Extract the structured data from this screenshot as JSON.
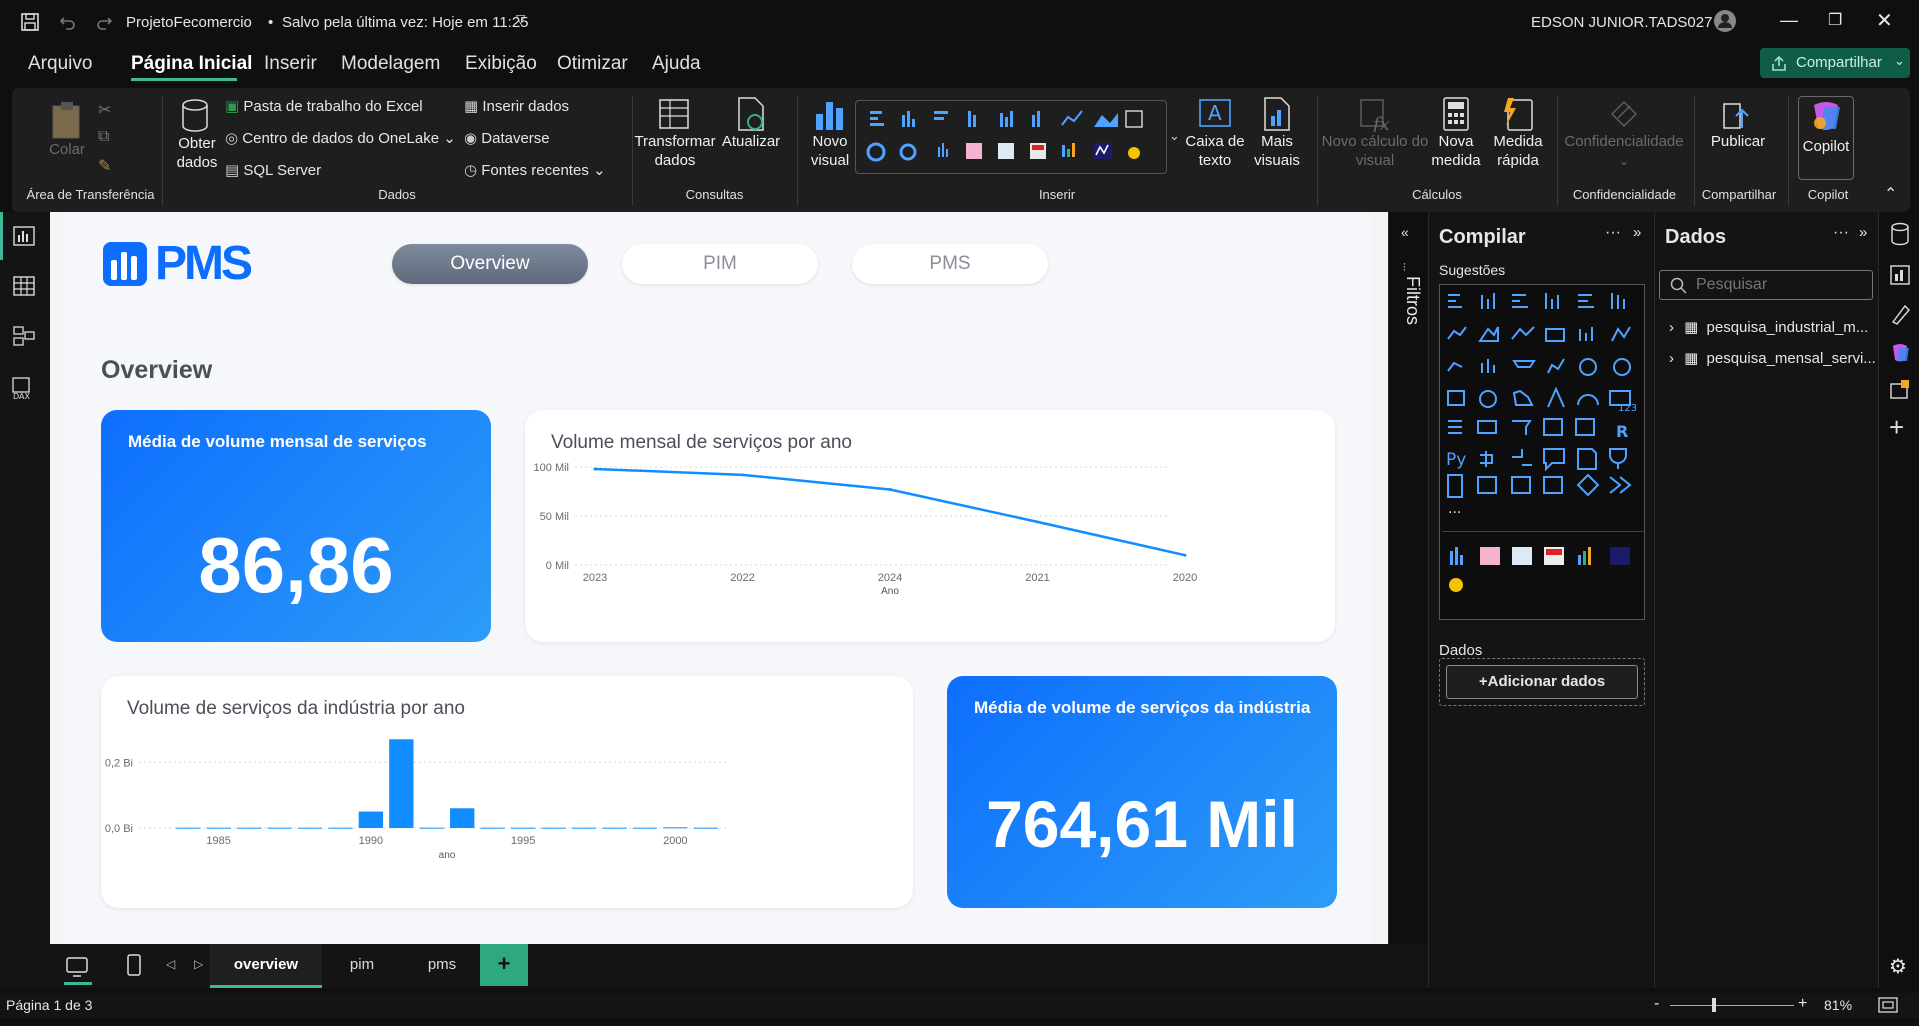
{
  "titlebar": {
    "title": "ProjetoFecomercio",
    "saved": "Salvo pela última vez: Hoje em 11:25",
    "user": "EDSON JUNIOR.TADS027"
  },
  "menu": [
    "Arquivo",
    "Página Inicial",
    "Inserir",
    "Modelagem",
    "Exibição",
    "Otimizar",
    "Ajuda"
  ],
  "share_label": "Compartilhar",
  "ribbon": {
    "paste": "Colar",
    "clipboard_group": "Área de Transferência",
    "get_data": "Obter dados",
    "excel": "Pasta de trabalho do Excel",
    "onelake": "Centro de dados do OneLake",
    "sql": "SQL Server",
    "insert_data": "Inserir dados",
    "dataverse": "Dataverse",
    "recent": "Fontes recentes",
    "data_group": "Dados",
    "transform": "Transformar dados",
    "refresh": "Atualizar",
    "queries_group": "Consultas",
    "new_visual": "Novo visual",
    "textbox": "Caixa de texto",
    "more_visuals": "Mais visuais",
    "insert_group": "Inserir",
    "new_calc": "Novo cálculo do visual",
    "new_measure": "Nova medida",
    "quick_measure": "Medida rápida",
    "calc_group": "Cálculos",
    "sensitivity": "Confidencialidade",
    "sensitivity_group": "Confidencialidade",
    "publish": "Publicar",
    "share_group": "Compartilhar",
    "copilot": "Copilot",
    "copilot_group": "Copilot"
  },
  "report": {
    "logo": "PMS",
    "tabs": [
      "Overview",
      "PIM",
      "PMS"
    ],
    "heading": "Overview",
    "kpi1": {
      "title": "Média de volume mensal de serviços",
      "value": "86,86"
    },
    "kpi2": {
      "title": "Média de volume de serviços da indústria",
      "value": "764,61 Mil"
    },
    "line_title": "Volume mensal de serviços por ano",
    "bar_title": "Volume de serviços da indústria por ano"
  },
  "chart_data": [
    {
      "type": "line",
      "title": "Volume mensal de serviços por ano",
      "xlabel": "Ano",
      "ylabel": "",
      "categories": [
        "2023",
        "2022",
        "2024",
        "2021",
        "2020"
      ],
      "values": [
        98,
        92,
        77,
        44,
        10
      ],
      "yticks": [
        "100 Mil",
        "50 Mil",
        "0 Mil"
      ],
      "ylim": [
        0,
        100
      ],
      "color": "#118dff"
    },
    {
      "type": "bar",
      "title": "Volume de serviços da indústria por ano",
      "xlabel": "ano",
      "ylabel": "",
      "x": [
        1984,
        1985,
        1986,
        1987,
        1988,
        1989,
        1990,
        1991,
        1992,
        1993,
        1994,
        1995,
        1996,
        1997,
        1998,
        1999,
        2000,
        2001
      ],
      "values": [
        0.001,
        0.001,
        0.001,
        0.001,
        0.001,
        0.001,
        0.05,
        0.27,
        0.001,
        0.06,
        0.001,
        0.001,
        0.001,
        0.001,
        0.001,
        0.001,
        0.002,
        0.001
      ],
      "xticks": [
        "1985",
        "1990",
        "1995",
        "2000"
      ],
      "yticks": [
        "0,2 Bi",
        "0,0 Bi"
      ],
      "ylim": [
        0,
        0.28
      ],
      "color": "#118dff"
    }
  ],
  "filters_label": "Filtros",
  "build": {
    "title": "Compilar",
    "suggestions": "Sugestões",
    "data_label": "Dados",
    "add_data": "+Adicionar dados"
  },
  "data_pane": {
    "title": "Dados",
    "search_placeholder": "Pesquisar",
    "tables": [
      "pesquisa_industrial_m...",
      "pesquisa_mensal_servi..."
    ]
  },
  "page_tabs": [
    "overview",
    "pim",
    "pms"
  ],
  "status": {
    "page": "Página 1 de 3",
    "zoom": "81%"
  }
}
